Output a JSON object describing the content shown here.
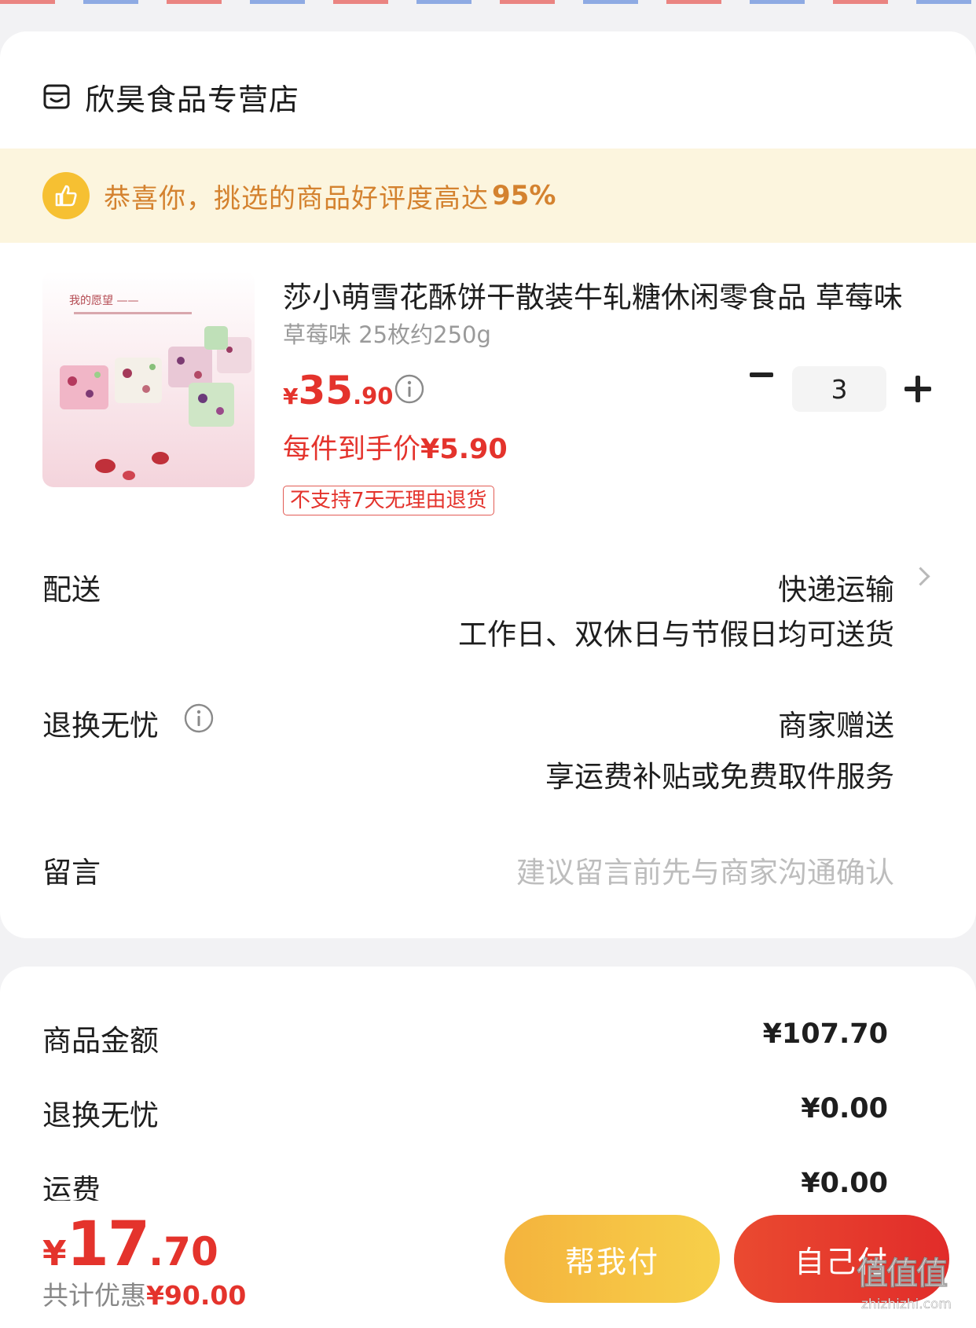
{
  "store": {
    "name": "欣昊食品专营店"
  },
  "banner": {
    "text": "恭喜你，挑选的商品好评度高达",
    "percent": "95%"
  },
  "product": {
    "title": "莎小萌雪花酥饼干散装牛轧糖休闲零食品 草莓味",
    "spec": "草莓味 25枚约250g",
    "price_currency": "¥",
    "price_int": "35",
    "price_dec": ".90",
    "unit_price_label": "每件到手价",
    "unit_price_value": "¥5.90",
    "tag": "不支持7天无理由退货",
    "quantity": "3"
  },
  "delivery": {
    "label": "配送",
    "method": "快递运输",
    "detail": "工作日、双休日与节假日均可送货"
  },
  "return_worry_free": {
    "label": "退换无忧",
    "value": "商家赠送",
    "detail": "享运费补贴或免费取件服务"
  },
  "message": {
    "label": "留言",
    "placeholder": "建议留言前先与商家沟通确认"
  },
  "summary": [
    {
      "label": "商品金额",
      "value": "¥107.70"
    },
    {
      "label": "退换无忧",
      "value": "¥0.00"
    },
    {
      "label": "运费",
      "value": "¥0.00"
    }
  ],
  "bottom": {
    "total_currency": "¥",
    "total_int": "17",
    "total_dec": ".70",
    "saving_label": "共计优惠",
    "saving_value": "¥90.00",
    "help_pay": "帮我付",
    "self_pay": "自己付"
  },
  "watermark": {
    "text": "值值值",
    "url": "zhizhizhi.com"
  },
  "colors": {
    "accent_red": "#e4332c",
    "banner_bg": "#fcf5de",
    "banner_text": "#d4822f",
    "help_btn": "#f4b33d",
    "self_btn": "#e12c2a"
  },
  "icons": [
    "store-icon",
    "thumbs-up-icon",
    "info-icon",
    "minus-icon",
    "plus-icon",
    "chevron-right-icon"
  ]
}
